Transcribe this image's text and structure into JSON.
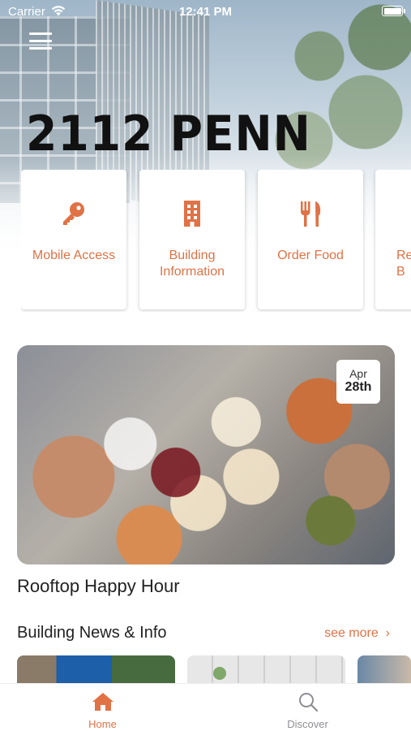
{
  "status_bar": {
    "carrier": "Carrier",
    "time": "12:41 PM",
    "battery_level": 1.0
  },
  "header": {
    "menu_icon": "hamburger-menu-icon",
    "building_name": "2112 PENN"
  },
  "quick_actions": [
    {
      "label": "Mobile Access",
      "icon": "key-icon"
    },
    {
      "label": "Building Information",
      "icon": "building-icon"
    },
    {
      "label": "Order Food",
      "icon": "fork-knife-icon"
    },
    {
      "label": "Re B",
      "icon": "unknown-icon"
    }
  ],
  "featured_event": {
    "title": "Rooftop Happy Hour",
    "date_month": "Apr",
    "date_day": "28th"
  },
  "news_section": {
    "title": "Building News & Info",
    "see_more": "see more"
  },
  "tab_bar": {
    "tabs": [
      {
        "label": "Home",
        "icon": "home-icon",
        "active": true
      },
      {
        "label": "Discover",
        "icon": "search-icon",
        "active": false
      }
    ]
  },
  "colors": {
    "accent": "#E07245",
    "title_text": "#111111",
    "inactive_tab": "#8E8E93"
  }
}
